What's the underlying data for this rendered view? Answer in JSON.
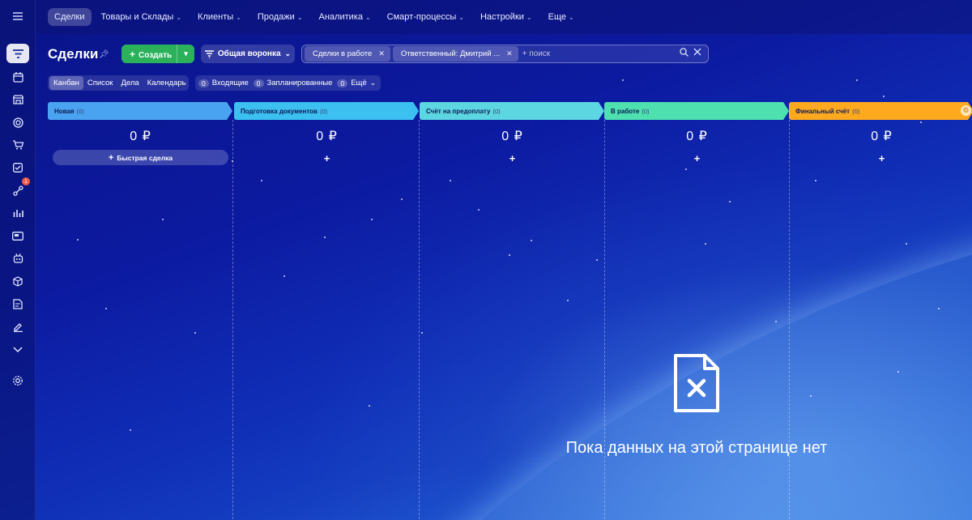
{
  "nav": {
    "items": [
      {
        "label": "Сделки",
        "active": true,
        "chevron": false
      },
      {
        "label": "Товары и Склады",
        "chevron": true
      },
      {
        "label": "Клиенты",
        "chevron": true
      },
      {
        "label": "Продажи",
        "chevron": true
      },
      {
        "label": "Аналитика",
        "chevron": true
      },
      {
        "label": "Смарт-процессы",
        "chevron": true
      },
      {
        "label": "Настройки",
        "chevron": true
      },
      {
        "label": "Еще",
        "chevron": true
      }
    ]
  },
  "sidebar": {
    "badge_count": "1",
    "icons": [
      "filter-icon",
      "calendar-icon",
      "store-icon",
      "target-icon",
      "cart-icon",
      "checklist-icon",
      "automation-icon",
      "analytics-icon",
      "payment-icon",
      "robot-icon",
      "box-icon",
      "document-icon",
      "sign-icon",
      "chevron-down-icon",
      "gear-icon"
    ]
  },
  "toolbar": {
    "title": "Сделки",
    "create_label": "Создать",
    "funnel_label": "Общая воронка",
    "filter_chips": [
      "Сделки в работе",
      "Ответственный: Дмитрий ..."
    ],
    "search_placeholder": "+ поиск"
  },
  "views": {
    "tabs": [
      {
        "label": "Канбан",
        "active": true
      },
      {
        "label": "Список"
      },
      {
        "label": "Дела"
      },
      {
        "label": "Календарь"
      }
    ],
    "counters": [
      {
        "count": "0",
        "label": "Входящие"
      },
      {
        "count": "0",
        "label": "Запланированные"
      },
      {
        "count": "0",
        "label": "Ещё"
      }
    ]
  },
  "kanban": {
    "columns": [
      {
        "title": "Новая",
        "count": "(0)",
        "sum": "0 ₽",
        "color": "#4aa3f0",
        "quick_deal": "Быстрая сделка"
      },
      {
        "title": "Подготовка документов",
        "count": "(0)",
        "sum": "0 ₽",
        "color": "#3cc0f0"
      },
      {
        "title": "Счёт на предоплату",
        "count": "(0)",
        "sum": "0 ₽",
        "color": "#5cd6e0"
      },
      {
        "title": "В работе",
        "count": "(0)",
        "sum": "0 ₽",
        "color": "#4fe0b0"
      },
      {
        "title": "Финальный счёт",
        "count": "(0)",
        "sum": "0 ₽",
        "color": "#ffaa1e"
      }
    ]
  },
  "empty_state": {
    "text": "Пока данных на этой странице нет"
  }
}
